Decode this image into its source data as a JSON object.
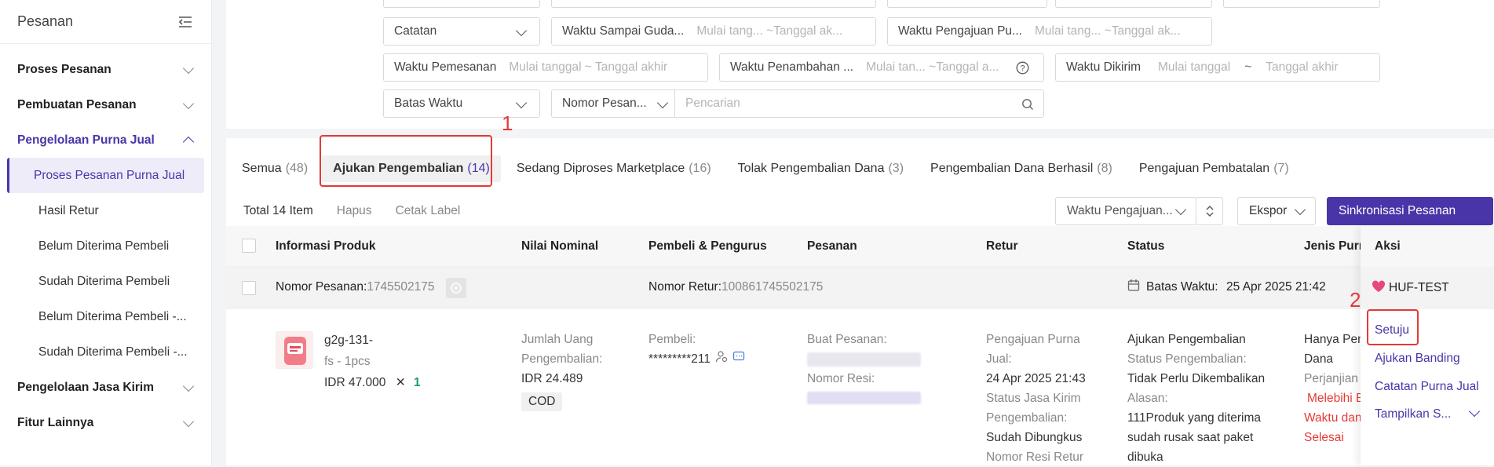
{
  "sidebar": {
    "title": "Pesanan",
    "menu": [
      {
        "label": "Proses Pesanan",
        "type": "group"
      },
      {
        "label": "Pembuatan Pesanan",
        "type": "group"
      },
      {
        "label": "Pengelolaan Purna Jual",
        "type": "group",
        "active": true
      },
      {
        "label": "Proses Pesanan Purna Jual",
        "type": "item",
        "active": true
      },
      {
        "label": "Hasil Retur",
        "type": "item"
      },
      {
        "label": "Belum Diterima Pembeli",
        "type": "item"
      },
      {
        "label": "Sudah Diterima Pembeli",
        "type": "item"
      },
      {
        "label": "Belum Diterima Pembeli -...",
        "type": "item"
      },
      {
        "label": "Sudah Diterima Pembeli -...",
        "type": "item"
      },
      {
        "label": "Pengelolaan Jasa Kirim",
        "type": "group"
      },
      {
        "label": "Fitur Lainnya",
        "type": "group"
      }
    ]
  },
  "filters": {
    "catatan": "Catatan",
    "waktu_sampai": {
      "label": "Waktu Sampai Guda...",
      "range": "Mulai tang... ~Tanggal ak..."
    },
    "waktu_pengajuan": {
      "label": "Waktu Pengajuan Pu...",
      "range": "Mulai tang... ~Tanggal ak..."
    },
    "waktu_pemesanan": {
      "label": "Waktu Pemesanan",
      "range": "Mulai tanggal ~ Tanggal akhir"
    },
    "waktu_penambahan": {
      "label": "Waktu Penambahan ...",
      "range": "Mulai tan... ~Tanggal a..."
    },
    "waktu_dikirim": {
      "label": "Waktu Dikirim",
      "start": "Mulai tanggal",
      "tilde": "~",
      "end": "Tanggal akhir"
    },
    "batas_waktu": "Batas Waktu",
    "nomor_pesanan": "Nomor Pesan...",
    "search_placeholder": "Pencarian"
  },
  "tabs": [
    {
      "label": "Semua",
      "count": "(48)"
    },
    {
      "label": "Ajukan Pengembalian",
      "count": "(14)",
      "active": true
    },
    {
      "label": "Sedang Diproses Marketplace",
      "count": "(16)"
    },
    {
      "label": "Tolak Pengembalian Dana",
      "count": "(3)"
    },
    {
      "label": "Pengembalian Dana Berhasil",
      "count": "(8)"
    },
    {
      "label": "Pengajuan Pembatalan",
      "count": "(7)"
    }
  ],
  "annotations": {
    "one": "1",
    "two": "2"
  },
  "toolbar": {
    "total": "Total 14 Item",
    "hapus": "Hapus",
    "cetak": "Cetak Label",
    "sort": "Waktu Pengajuan...",
    "ekspor": "Ekspor",
    "sync": "Sinkronisasi Pesanan"
  },
  "columns": {
    "produk": "Informasi Produk",
    "nominal": "Nilai Nominal",
    "pembeli": "Pembeli & Pengurus",
    "pesanan": "Pesanan",
    "retur": "Retur",
    "status": "Status",
    "jenis": "Jenis Purna",
    "aksi": "Aksi"
  },
  "order": {
    "nomor_label": "Nomor Pesanan:",
    "nomor": "1745502175",
    "retur_label": "Nomor Retur:",
    "retur": "100861745502175",
    "batas_label": "Batas Waktu:",
    "batas": "25 Apr 2025 21:42",
    "shop": "HUF-TEST",
    "product_name": "g2g-131-",
    "variant": "fs - 1pcs",
    "price": "IDR 47.000",
    "qty_x": "✕",
    "qty": "1",
    "jumlah_label1": "Jumlah Uang",
    "jumlah_label2": "Pengembalian:",
    "jumlah": "IDR 24.489",
    "cod": "COD",
    "pembeli_label": "Pembeli:",
    "pembeli": "*********211",
    "buat_pesanan": "Buat Pesanan:",
    "nomor_resi": "Nomor Resi:",
    "pengajuan_label1": "Pengajuan Purna",
    "pengajuan_label2": "Jual:",
    "pengajuan": "24 Apr 2025 21:43",
    "status_jasa1": "Status Jasa Kirim",
    "status_jasa2": "Pengembalian:",
    "status_jasa": "Sudah Dibungkus",
    "nomor_resi_retur": "Nomor Resi Retur",
    "status_main": "Ajukan Pengembalian",
    "status_peng_label": "Status Pengembalian:",
    "status_peng": "Tidak Perlu Dikembalikan",
    "alasan_label": "Alasan:",
    "alasan1": "111Produk yang diterima",
    "alasan2": "sudah rusak saat paket",
    "alasan3": "dibuka",
    "jenis1": "Hanya Pen",
    "jenis2": "Dana",
    "perjanjian": "Perjanjian L",
    "melebihi": "Melebihi B",
    "waktu_dan": "Waktu dan",
    "selesai": "Selesai"
  },
  "actions": {
    "setuju": "Setuju",
    "banding": "Ajukan Banding",
    "catatan": "Catatan Purna Jual",
    "tampilkan": "Tampilkan S..."
  },
  "colors": {
    "accent": "#4a35a8",
    "annotation": "#e53935"
  }
}
